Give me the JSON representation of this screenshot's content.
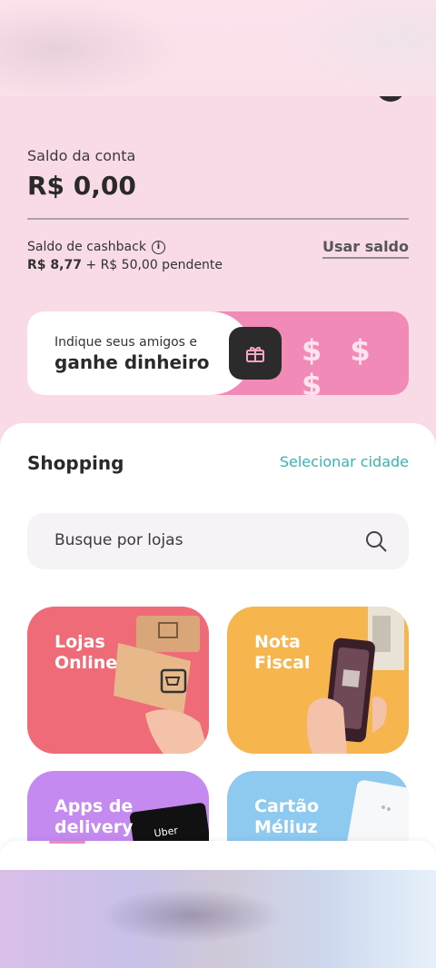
{
  "account": {
    "balance_label": "Saldo da conta",
    "balance_value": "R$ 0,00"
  },
  "cashback": {
    "label": "Saldo de cashback",
    "value": "R$ 8,77",
    "pending": "+ R$ 50,00 pendente",
    "use_balance": "Usar saldo"
  },
  "referral": {
    "line1": "Indique seus amigos e",
    "line2": "ganhe dinheiro",
    "dollars": "$ $ $"
  },
  "shopping": {
    "title": "Shopping",
    "select_city": "Selecionar cidade",
    "search_placeholder": "Busque por lojas"
  },
  "cards": [
    {
      "title": "Lojas Online"
    },
    {
      "title": "Nota Fiscal"
    },
    {
      "title": "Apps de delivery",
      "badge": "Uber"
    },
    {
      "title": "Cartão Méliuz"
    }
  ],
  "colors": {
    "accent_teal": "#39b3b0",
    "pink": "#f28ab7",
    "card_red": "#ef6b78",
    "card_orange": "#f6b54d",
    "card_purple": "#c58af0",
    "card_blue": "#8ec9ef"
  }
}
